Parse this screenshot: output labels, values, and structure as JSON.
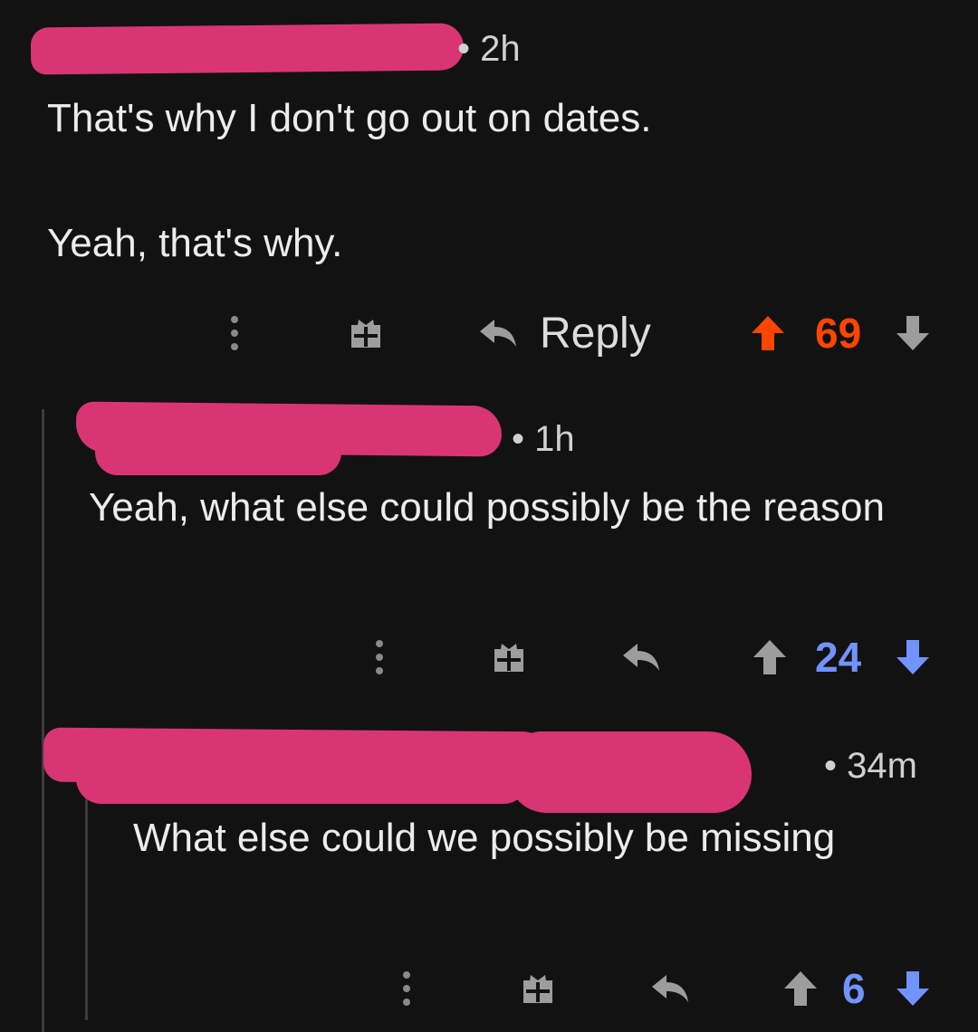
{
  "colors": {
    "background": "#121212",
    "text": "#ececec",
    "muted": "#9a9a9a",
    "upvoted": "#ff4500",
    "downvote_blue": "#7193ff",
    "redaction": "#d93574",
    "thread_line": "#3c3c3c"
  },
  "comments": [
    {
      "time": "• 2h",
      "body": [
        "That's why I don't go out on dates.",
        "Yeah, that's why."
      ],
      "reply_label": "Reply",
      "score": "69",
      "vote_state": "upvoted",
      "icons": [
        "more-options-icon",
        "award-icon",
        "reply-icon",
        "upvote-icon",
        "downvote-icon"
      ]
    },
    {
      "time": "• 1h",
      "body": [
        "Yeah, what else could possibly be the reason"
      ],
      "score": "24",
      "vote_state": "downvoted",
      "icons": [
        "more-options-icon",
        "award-icon",
        "reply-icon",
        "upvote-icon",
        "downvote-icon"
      ]
    },
    {
      "time": "• 34m",
      "body": [
        "What else could we possibly be missing"
      ],
      "score": "6",
      "vote_state": "downvoted",
      "icons": [
        "more-options-icon",
        "award-icon",
        "reply-icon",
        "upvote-icon",
        "downvote-icon"
      ]
    }
  ]
}
